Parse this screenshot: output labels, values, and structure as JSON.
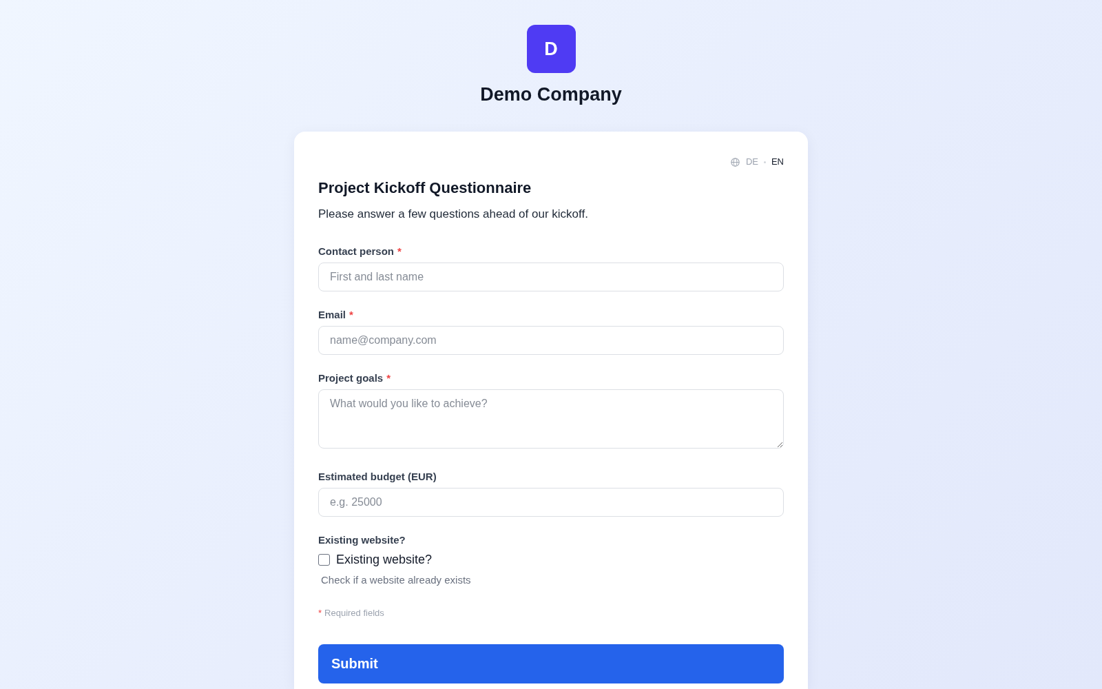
{
  "header": {
    "logo_letter": "D",
    "company_name": "Demo Company"
  },
  "form": {
    "languages": [
      {
        "label": "DE",
        "selected": false
      },
      {
        "label": "EN",
        "selected": true
      }
    ],
    "title": "Project Kickoff Questionnaire",
    "subtitle": "Please answer a few questions ahead of our kickoff.",
    "fields": [
      {
        "kind": "text",
        "label": "Contact person",
        "required_mark": "*",
        "placeholder": "First and last name"
      },
      {
        "kind": "email",
        "label": "Email",
        "required_mark": "*",
        "placeholder": "name@company.com"
      },
      {
        "kind": "textarea",
        "label": "Project goals",
        "required_mark": "*",
        "placeholder": "What would you like to achieve?"
      },
      {
        "kind": "number",
        "label": "Estimated budget (EUR)",
        "placeholder": "e.g. 25000"
      },
      {
        "kind": "checkbox",
        "label": "Existing website?",
        "checkbox_label": "Existing website?",
        "checked": false,
        "help": "Check if a website already exists"
      }
    ],
    "required_note": {
      "mark": "*",
      "text": "Required fields"
    },
    "submit_label": "Submit"
  }
}
